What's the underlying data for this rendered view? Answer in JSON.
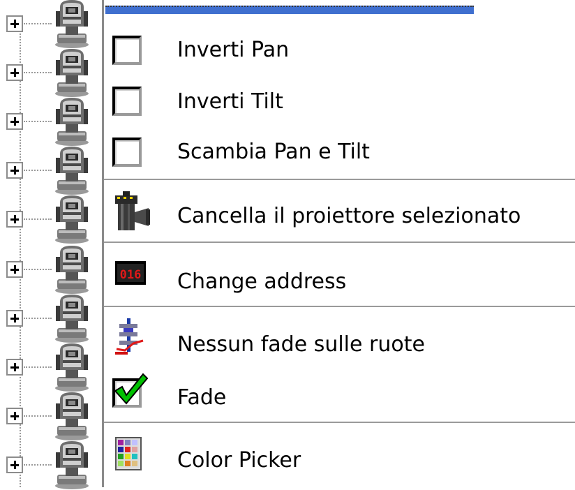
{
  "tree": {
    "rows": [
      {
        "expander": "+",
        "icon": "fixture-icon"
      },
      {
        "expander": "+",
        "icon": "fixture-icon"
      },
      {
        "expander": "+",
        "icon": "fixture-icon"
      },
      {
        "expander": "+",
        "icon": "fixture-icon"
      },
      {
        "expander": "+",
        "icon": "fixture-icon"
      },
      {
        "expander": "+",
        "icon": "fixture-icon"
      },
      {
        "expander": "+",
        "icon": "fixture-icon"
      },
      {
        "expander": "+",
        "icon": "fixture-icon"
      },
      {
        "expander": "+",
        "icon": "fixture-icon"
      },
      {
        "expander": "+",
        "icon": "fixture-icon"
      }
    ]
  },
  "menu": {
    "invert_pan": {
      "label": "Inverti Pan",
      "checked": false,
      "icon": "checkbox-icon"
    },
    "invert_tilt": {
      "label": "Inverti Tilt",
      "checked": false,
      "icon": "checkbox-icon"
    },
    "swap_pan_tilt": {
      "label": "Scambia Pan e Tilt",
      "checked": false,
      "icon": "checkbox-icon"
    },
    "delete_fixture": {
      "label": "Cancella il proiettore selezionato",
      "icon": "trash-icon"
    },
    "change_address": {
      "label": "Change address",
      "icon": "address-icon",
      "icon_text": "016"
    },
    "no_fade_wheels": {
      "label": "Nessun fade sulle ruote",
      "icon": "no-fade-icon"
    },
    "fade": {
      "label": "Fade",
      "checked": true,
      "icon": "checkbox-checked-icon"
    },
    "color_picker": {
      "label": "Color Picker",
      "icon": "color-grid-icon"
    }
  },
  "colors": {
    "highlight": "#3f6fcf",
    "checkmark": "#00c000",
    "address_red": "#e01818"
  }
}
